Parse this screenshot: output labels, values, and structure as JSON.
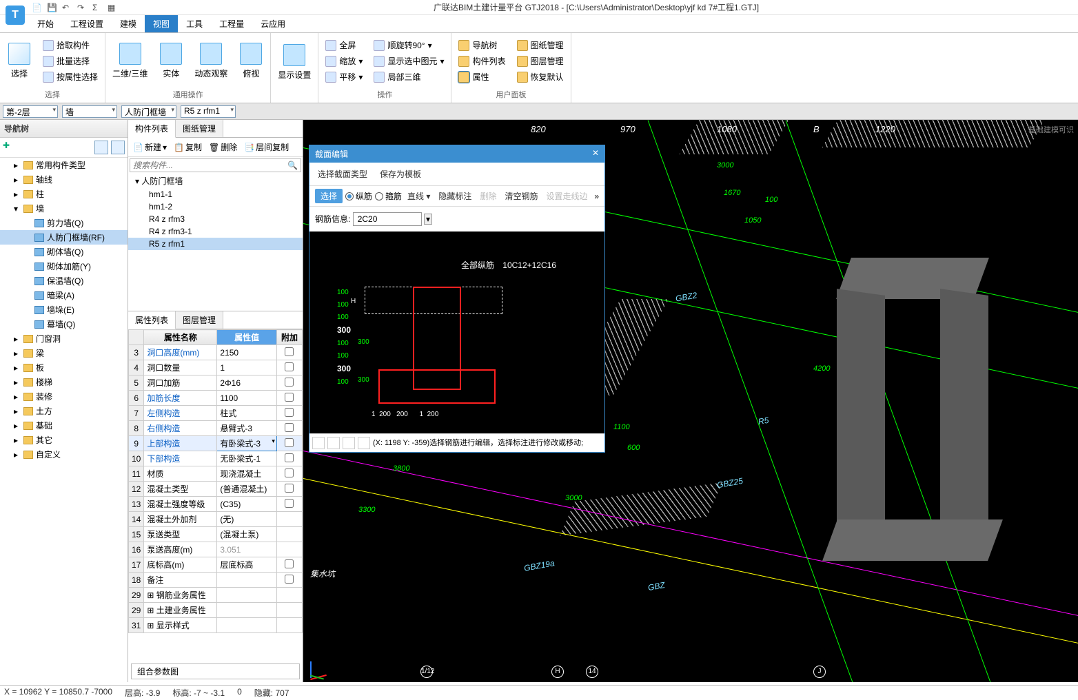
{
  "title": "广联达BIM土建计量平台 GTJ2018 - [C:\\Users\\Administrator\\Desktop\\yjf kd 7#工程1.GTJ]",
  "menus": [
    "开始",
    "工程设置",
    "建模",
    "视图",
    "工具",
    "工程量",
    "云应用"
  ],
  "menu_active": "视图",
  "ribbon": {
    "g1": {
      "btn": "选择",
      "a": "拾取构件",
      "b": "批量选择",
      "c": "按属性选择",
      "label": "选择"
    },
    "g2": {
      "a": "二维/三维",
      "b": "实体",
      "c": "动态观察",
      "d": "俯视",
      "label": "通用操作"
    },
    "g3": {
      "a": "显示设置"
    },
    "g4": {
      "a1": "全屏",
      "a2": "顺旋转90°",
      "b1": "缩放",
      "b2": "显示选中图元",
      "c1": "平移",
      "c2": "局部三维",
      "label": "操作"
    },
    "g5": {
      "a1": "导航树",
      "a2": "图纸管理",
      "b1": "构件列表",
      "b2": "图层管理",
      "c1": "属性",
      "c2": "恢复默认",
      "label": "用户面板"
    }
  },
  "combos": {
    "floor": "第-2层",
    "cat": "墙",
    "sub": "人防门框墙",
    "inst": "R5 z rfm1"
  },
  "nav": {
    "title": "导航树",
    "items": [
      {
        "t": "常用构件类型",
        "l": 1
      },
      {
        "t": "轴线",
        "l": 1
      },
      {
        "t": "柱",
        "l": 1
      },
      {
        "t": "墙",
        "l": 1,
        "open": true
      },
      {
        "t": "剪力墙(Q)",
        "l": 2,
        "ic": "blue"
      },
      {
        "t": "人防门框墙(RF)",
        "l": 2,
        "ic": "blue",
        "sel": true
      },
      {
        "t": "砌体墙(Q)",
        "l": 2,
        "ic": "blue"
      },
      {
        "t": "砌体加筋(Y)",
        "l": 2,
        "ic": "blue"
      },
      {
        "t": "保温墙(Q)",
        "l": 2,
        "ic": "blue"
      },
      {
        "t": "暗梁(A)",
        "l": 2,
        "ic": "blue"
      },
      {
        "t": "墙垛(E)",
        "l": 2,
        "ic": "blue"
      },
      {
        "t": "幕墙(Q)",
        "l": 2,
        "ic": "blue"
      },
      {
        "t": "门窗洞",
        "l": 1
      },
      {
        "t": "梁",
        "l": 1
      },
      {
        "t": "板",
        "l": 1
      },
      {
        "t": "楼梯",
        "l": 1
      },
      {
        "t": "装修",
        "l": 1
      },
      {
        "t": "土方",
        "l": 1
      },
      {
        "t": "基础",
        "l": 1
      },
      {
        "t": "其它",
        "l": 1
      },
      {
        "t": "自定义",
        "l": 1
      }
    ]
  },
  "mid": {
    "tabs": [
      "构件列表",
      "图纸管理"
    ],
    "toolbar": {
      "new": "新建",
      "copy": "复制",
      "del": "删除",
      "layer": "层间复制"
    },
    "search_ph": "搜索构件...",
    "group": "人防门框墙",
    "items": [
      "hm1-1",
      "hm1-2",
      "R4 z rfm3",
      "R4 z rfm3-1",
      "R5 z rfm1"
    ],
    "sel": "R5 z rfm1"
  },
  "props": {
    "tabs": [
      "属性列表",
      "图层管理"
    ],
    "cols": {
      "name": "属性名称",
      "val": "属性值",
      "add": "附加"
    },
    "rows": [
      {
        "n": 3,
        "name": "洞口高度(mm)",
        "v": "2150",
        "link": true,
        "cb": true
      },
      {
        "n": 4,
        "name": "洞口数量",
        "v": "1",
        "cb": true
      },
      {
        "n": 5,
        "name": "洞口加筋",
        "v": "2Φ16",
        "cb": true
      },
      {
        "n": 6,
        "name": "加筋长度",
        "v": "1100",
        "link": true,
        "cb": true
      },
      {
        "n": 7,
        "name": "左侧构造",
        "v": "柱式",
        "link": true,
        "cb": true
      },
      {
        "n": 8,
        "name": "右侧构造",
        "v": "悬臂式-3",
        "link": true,
        "cb": true
      },
      {
        "n": 9,
        "name": "上部构造",
        "v": "有卧梁式-3",
        "link": true,
        "sel": true,
        "edit": true,
        "cb": true
      },
      {
        "n": 10,
        "name": "下部构造",
        "v": "无卧梁式-1",
        "link": true,
        "cb": true
      },
      {
        "n": 11,
        "name": "材质",
        "v": "现浇混凝土",
        "cb": true
      },
      {
        "n": 12,
        "name": "混凝土类型",
        "v": "(普通混凝土)",
        "cb": true
      },
      {
        "n": 13,
        "name": "混凝土强度等级",
        "v": "(C35)",
        "cb": true
      },
      {
        "n": 14,
        "name": "混凝土外加剂",
        "v": "(无)"
      },
      {
        "n": 15,
        "name": "泵送类型",
        "v": "(混凝土泵)"
      },
      {
        "n": 16,
        "name": "泵送高度(m)",
        "v": "3.051",
        "gray": true
      },
      {
        "n": 17,
        "name": "底标高(m)",
        "v": "层底标高",
        "cb": true
      },
      {
        "n": 18,
        "name": "备注",
        "v": "",
        "cb": true
      },
      {
        "n": 29,
        "name": "钢筋业务属性",
        "exp": true
      },
      {
        "n": 29,
        "name": "土建业务属性",
        "exp": true,
        "alt": true
      },
      {
        "n": 31,
        "name": "显示样式",
        "exp": true
      }
    ],
    "footer": "组合参数图"
  },
  "section": {
    "title": "截面编辑",
    "row1a": "选择截面类型",
    "row1b": "保存为模板",
    "sel": "选择",
    "r1": "纵筋",
    "r2": "箍筋",
    "b1": "直线",
    "b2": "隐藏标注",
    "b3": "删除",
    "b4": "清空钢筋",
    "b5": "设置走线边",
    "label": "钢筋信息:",
    "value": "2C20",
    "annot_all": "全部纵筋",
    "annot_code": "10C12+12C16",
    "dims": [
      "100",
      "100",
      "100",
      "300",
      "100",
      "100",
      "300",
      "100",
      "1",
      "200",
      "200",
      "1",
      "200"
    ],
    "status": "(X: 1198 Y: -359)选择钢筋进行编辑，选择标注进行修改或移动;"
  },
  "canvas": {
    "axis_top": [
      "820",
      "970",
      "1/12",
      "H",
      "1080",
      "14",
      "1220",
      "J"
    ],
    "dims": [
      "1670",
      "3000",
      "4200",
      "3800",
      "3000",
      "1100",
      "600",
      "1050",
      "3300",
      "100"
    ],
    "labels": [
      "GBZ19a",
      "GBZ25",
      "GBZ",
      "R5",
      "GBZ2",
      "集水坑"
    ],
    "watermark": "基础建模可识"
  },
  "status": {
    "left": "X = 10962 Y = 10850.7    -7000",
    "a": "层高: -3.9",
    "b": "标高: -7 ~ -3.1",
    "c": "0",
    "d": "隐藏: 707"
  }
}
